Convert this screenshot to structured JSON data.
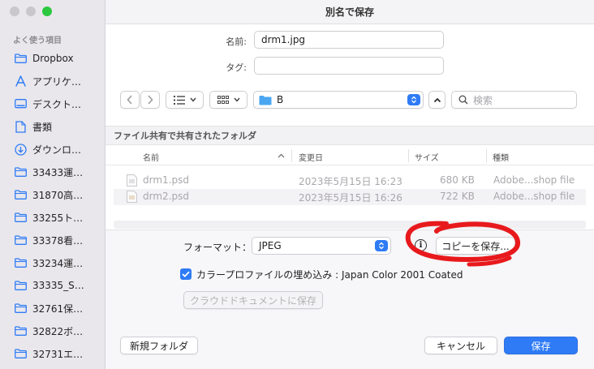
{
  "window": {
    "title": "別名で保存"
  },
  "sidebar": {
    "heading": "よく使う項目",
    "items": [
      {
        "label": "Dropbox",
        "icon": "folder-icon"
      },
      {
        "label": "アプリケ…",
        "icon": "applications-icon"
      },
      {
        "label": "デスクト…",
        "icon": "desktop-icon"
      },
      {
        "label": "書類",
        "icon": "document-icon"
      },
      {
        "label": "ダウンロ…",
        "icon": "download-icon"
      },
      {
        "label": "33433運…",
        "icon": "folder-icon"
      },
      {
        "label": "31870高…",
        "icon": "folder-icon"
      },
      {
        "label": "33255ト…",
        "icon": "folder-icon"
      },
      {
        "label": "33378看…",
        "icon": "folder-icon"
      },
      {
        "label": "33234運…",
        "icon": "folder-icon"
      },
      {
        "label": "33335_S…",
        "icon": "folder-icon"
      },
      {
        "label": "32761保…",
        "icon": "folder-icon"
      },
      {
        "label": "32822ボ…",
        "icon": "folder-icon"
      },
      {
        "label": "32731エ…",
        "icon": "folder-icon"
      }
    ]
  },
  "form": {
    "name_label": "名前:",
    "name_value": "drm1.jpg",
    "tags_label": "タグ:",
    "tags_value": ""
  },
  "toolbar": {
    "location": "B",
    "search_placeholder": "検索"
  },
  "browser": {
    "section_title": "ファイル共有で共有されたフォルダ",
    "columns": {
      "name": "名前",
      "modified": "変更日",
      "size": "サイズ",
      "kind": "種類"
    },
    "files": [
      {
        "name": "drm1.psd",
        "modified": "2023年5月15日 16:23",
        "size": "680 KB",
        "kind": "Adobe...shop file"
      },
      {
        "name": "drm2.psd",
        "modified": "2023年5月15日 16:26",
        "size": "722 KB",
        "kind": "Adobe...shop file"
      }
    ]
  },
  "options": {
    "format_label": "フォーマット：",
    "format_value": "JPEG",
    "save_copy_label": "コピーを保存...",
    "embed_profile_label": "カラープロファイルの埋め込み : Japan Color 2001 Coated",
    "cloud_save_label": "クラウドドキュメントに保存"
  },
  "footer": {
    "new_folder_label": "新規フォルダ",
    "cancel_label": "キャンセル",
    "save_label": "保存"
  },
  "colors": {
    "accent": "#2f7bf6",
    "annotation": "#e8191c"
  }
}
